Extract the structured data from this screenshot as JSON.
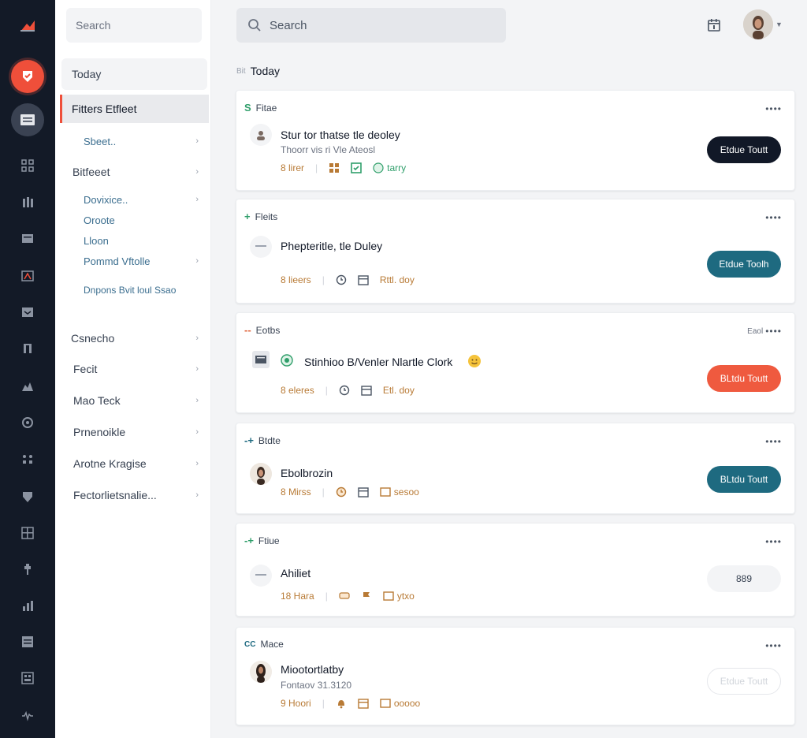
{
  "sidebar": {
    "search_placeholder": "Search",
    "today": "Today",
    "active_item": "Fitters Etfleet",
    "items": [
      {
        "label": "Sbeet..",
        "chevron": "›"
      },
      {
        "label": "Bitfeeet",
        "chevron": "›"
      },
      {
        "label": "Dovixice..",
        "chevron": "›"
      },
      {
        "label": "Oroote",
        "chevron": ""
      },
      {
        "label": "Lloon",
        "chevron": ""
      },
      {
        "label": "Pommd Vftolle",
        "chevron": "›"
      },
      {
        "label": "Dnpons Bvit loul Ssao",
        "chevron": ""
      },
      {
        "label": "Csnecho",
        "chevron": "›"
      },
      {
        "label": "Fecit",
        "chevron": "›"
      },
      {
        "label": "Mao Teck",
        "chevron": "›"
      },
      {
        "label": "Prnenoikle",
        "chevron": "›"
      },
      {
        "label": "Arotne Kragise",
        "chevron": "›"
      },
      {
        "label": "Fectorlietsnalie...",
        "chevron": "›"
      }
    ]
  },
  "topbar": {
    "search_placeholder": "Search"
  },
  "main": {
    "section_title": "Today",
    "section_prefix": "Bit",
    "cards": [
      {
        "tag": "Fitae",
        "tag_mark": "S",
        "tag_color": "#2f9e6a",
        "more": "",
        "title": "Stur tor thatse tle deoley",
        "subtitle": "Thoorr vis ri Vle Ateosl",
        "meta_count": "8 lirer",
        "meta_badge": "tarry",
        "cta": "Etdue Toutt",
        "cta_style": "dark"
      },
      {
        "tag": "Fleits",
        "tag_mark": "+",
        "tag_color": "#2f9e6a",
        "more": "",
        "title": "Phepteritle, tle Duley",
        "subtitle": "",
        "meta_count": "8 lieers",
        "meta_badge": "Rttl. doy",
        "cta": "Etdue Toolh",
        "cta_style": "teal"
      },
      {
        "tag": "Eotbs",
        "tag_mark": "--",
        "tag_color": "#e0683f",
        "more": "Eaol",
        "title": "Stinhioo B/Venler Nlartle Clork",
        "subtitle": "",
        "meta_count": "8 eleres",
        "meta_badge": "Etl. doy",
        "cta": "BLtdu Toutt",
        "cta_style": "orange"
      },
      {
        "tag": "Btdte",
        "tag_mark": "-+",
        "tag_color": "#1e6a80",
        "more": "",
        "title": "Ebolbrozin",
        "subtitle": "",
        "meta_count": "8 Mirss",
        "meta_badge": "sesoo",
        "cta": "BLtdu Toutt",
        "cta_style": "teal"
      },
      {
        "tag": "Ftiue",
        "tag_mark": "-+",
        "tag_color": "#2f9e6a",
        "more": "",
        "title": "Ahiliet",
        "subtitle": "",
        "meta_count": "18 Hara",
        "meta_badge": "ytxo",
        "cta": "889",
        "cta_style": "grey"
      },
      {
        "tag": "Mace",
        "tag_mark": "CC",
        "tag_color": "#1e6a80",
        "more": "",
        "title": "Miootortlatby",
        "subtitle": "Fontaov 31.3120",
        "meta_count": "9 Hoori",
        "meta_badge": "ooooo",
        "cta": "Etdue Toutt",
        "cta_style": "ghost"
      }
    ]
  },
  "colors": {
    "rail_bg": "#131a27",
    "accent": "#ef4f3a",
    "teal": "#1e6a80",
    "dark_button": "#111827",
    "green": "#2f9e6a",
    "amber_text": "#b87a35"
  },
  "icons": {
    "rail": [
      "home-icon",
      "grid-icon",
      "columns-icon",
      "folder-icon",
      "map-icon",
      "inbox-icon",
      "tower-icon",
      "analytics-icon",
      "shield-icon",
      "apps-icon",
      "badge-icon",
      "layout-icon",
      "pin-icon",
      "bar-chart-icon",
      "table-icon",
      "dashboard-icon",
      "settings-icon"
    ],
    "top": [
      "search-icon",
      "calendar-icon",
      "chevron-down-icon"
    ]
  }
}
